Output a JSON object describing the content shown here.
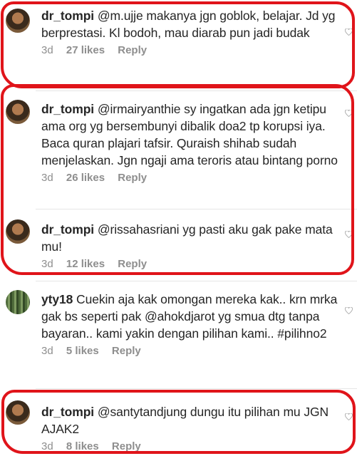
{
  "comments": [
    {
      "user": "dr_tompi",
      "text": "@m.ujje makanya jgn goblok, belajar. Jd yg berprestasi. Kl bodoh, mau diarab pun jadi budak",
      "time": "3d",
      "likes": "27 likes",
      "reply": "Reply",
      "avatar": "dr-tompi-avatar"
    },
    {
      "user": "dr_tompi",
      "text": "@irmairyanthie sy ingatkan ada jgn ketipu ama org yg bersembunyi dibalik doa2 tp korupsi iya. Baca quran plajari tafsir. Quraish shihab sudah menjelaskan. Jgn ngaji ama teroris atau bintang porno",
      "time": "3d",
      "likes": "26 likes",
      "reply": "Reply",
      "avatar": "dr-tompi-avatar"
    },
    {
      "user": "dr_tompi",
      "text": "@rissahasriani yg pasti aku gak pake mata mu!",
      "time": "3d",
      "likes": "12 likes",
      "reply": "Reply",
      "avatar": "dr-tompi-avatar"
    },
    {
      "user": "yty18",
      "text": "Cuekin aja kak omongan mereka kak.. krn mrka gak bs seperti pak @ahokdjarot yg smua dtg tanpa bayaran.. kami yakin dengan pilihan kami.. #pilihno2",
      "time": "3d",
      "likes": "5 likes",
      "reply": "Reply",
      "avatar": "yty18-avatar"
    },
    {
      "user": "dr_tompi",
      "text": "@santytandjung dungu itu pilihan mu JGN AJAK2",
      "time": "3d",
      "likes": "8 likes",
      "reply": "Reply",
      "avatar": "dr-tompi-avatar"
    }
  ],
  "icons": {
    "like": "heart-outline-icon"
  },
  "colors": {
    "highlight": "#e0141a",
    "meta": "#8e8e8e"
  }
}
